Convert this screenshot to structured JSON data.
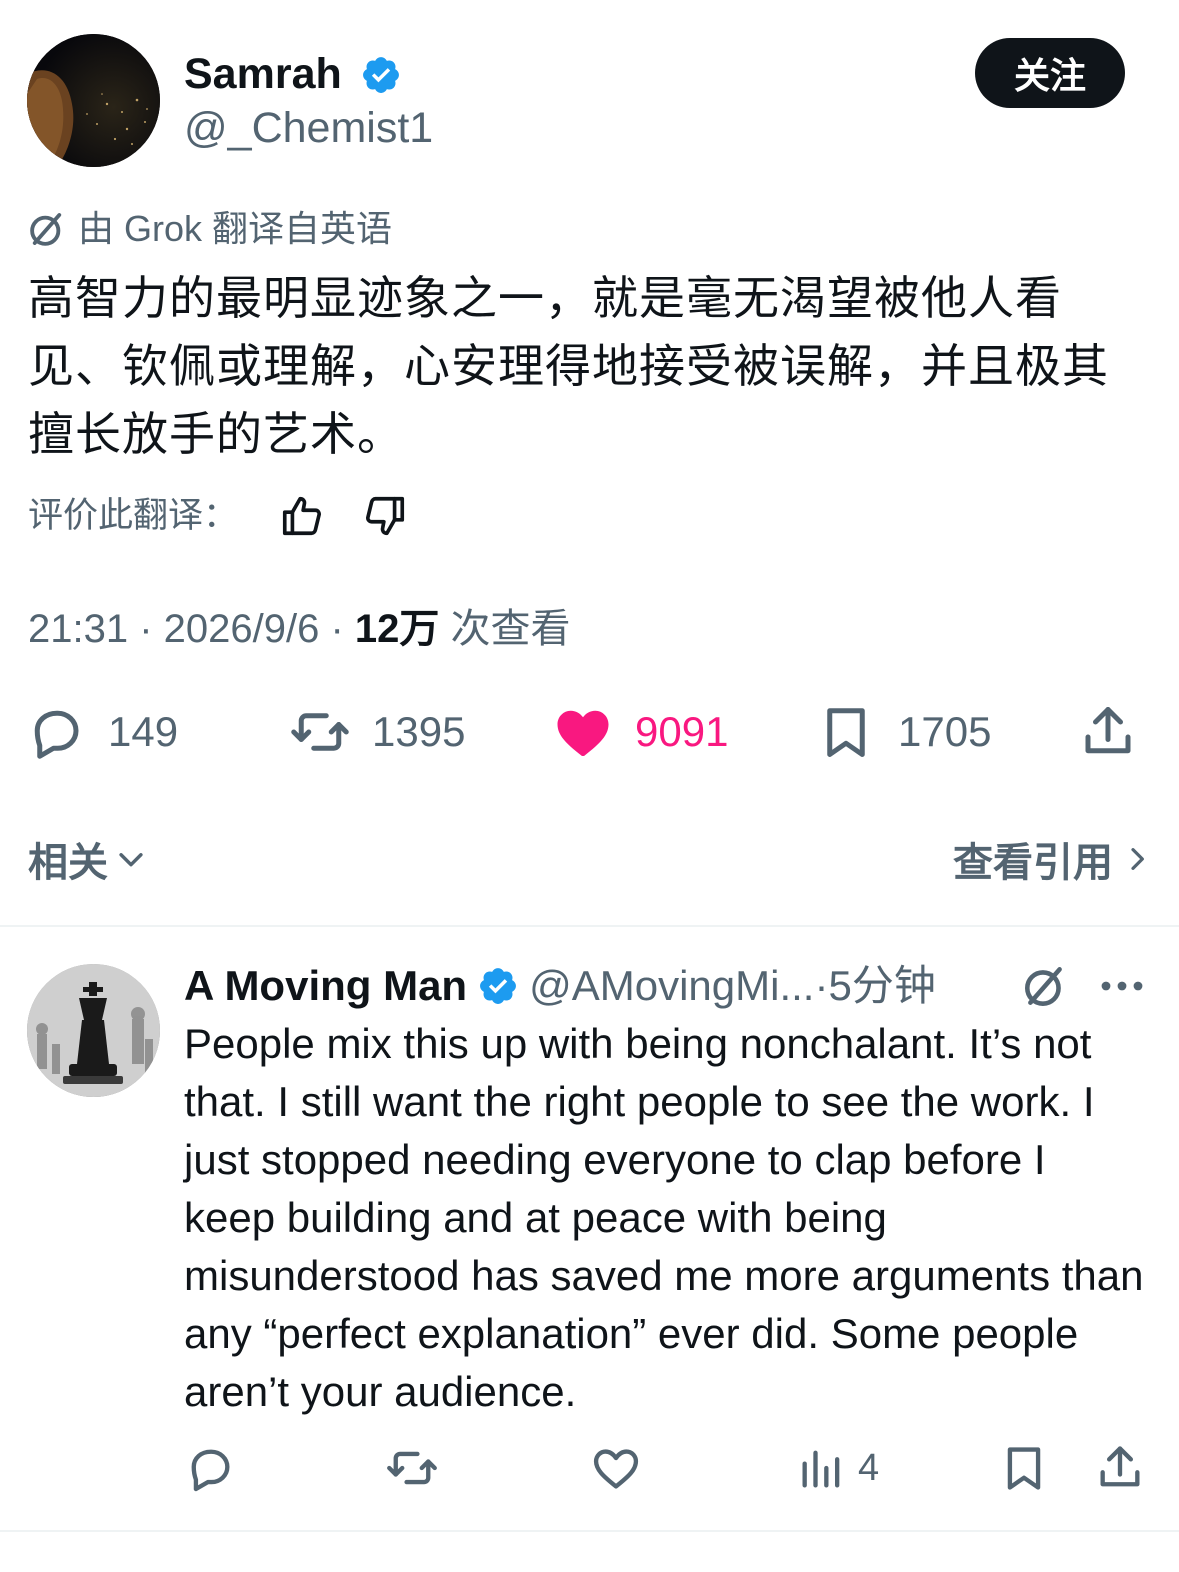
{
  "tweet": {
    "author": {
      "display_name": "Samrah",
      "handle": "@_Chemist1",
      "verified": true
    },
    "follow_label": "关注",
    "translation_note": "由 Grok 翻译自英语",
    "text": "高智力的最明显迹象之一，就是毫无渴望被他人看见、钦佩或理解，心安理得地接受被误解，并且极其擅长放手的艺术。",
    "rate_label": "评价此翻译：",
    "time": "21:31",
    "date": "2026/9/6",
    "views_count": "12万",
    "views_label": "次查看",
    "actions": {
      "replies": "149",
      "reposts": "1395",
      "likes": "9091",
      "bookmarks": "1705"
    }
  },
  "related": {
    "label": "相关",
    "view_quotes": "查看引用"
  },
  "reply": {
    "display_name": "A Moving Man",
    "handle": "@AMovingMi...",
    "time": "5分钟",
    "text": "People mix this up with being nonchalant. It’s not that. I still want the right people to see the work. I just stopped needing everyone to clap before I keep building and at peace with being misunderstood has saved me more arguments than any “perfect explanation” ever did. Some people aren’t your audience.",
    "views": "4"
  },
  "colors": {
    "text": "#0f1419",
    "secondary": "#536471",
    "verified": "#1d9bf0",
    "like": "#f91880",
    "divider": "#eff3f4"
  },
  "icons": [
    "verified-badge-icon",
    "grok-icon",
    "thumbs-up-icon",
    "thumbs-down-icon",
    "reply-icon",
    "repost-icon",
    "heart-icon",
    "bookmark-icon",
    "share-icon",
    "chevron-down-icon",
    "chevron-right-icon",
    "more-icon",
    "analytics-icon"
  ]
}
